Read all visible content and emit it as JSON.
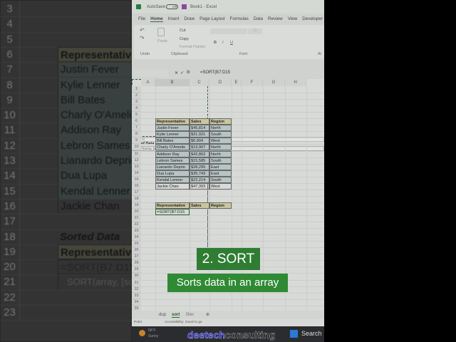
{
  "titlebar": {
    "autosave": "AutoSave",
    "toggle": "Off",
    "doc": "Book1 - Excel"
  },
  "tabs": [
    "File",
    "Home",
    "Insert",
    "Draw",
    "Page Layout",
    "Formulas",
    "Data",
    "Review",
    "View",
    "Developer"
  ],
  "ribbon": {
    "cut": "Cut",
    "copy": "Copy",
    "format_painter": "Format Painter",
    "paste": "Paste",
    "groups": [
      "Undo",
      "Clipboard",
      "Font",
      "Al"
    ],
    "font_size": "11",
    "bold": "B",
    "italic": "I",
    "underline": "U"
  },
  "formula_bar": {
    "fx": "fx",
    "formula": "=SORT(B7:D15"
  },
  "columns": [
    "A",
    "B",
    "C",
    "D",
    "E",
    "F",
    "G",
    "H"
  ],
  "table": {
    "headers": [
      "Representative",
      "Sales",
      "Region"
    ],
    "rows": [
      [
        "Justin Fever",
        "$45,814",
        "North"
      ],
      [
        "Kylie Lenner",
        "$31,921",
        "South"
      ],
      [
        "Bill Bates",
        "$6,904",
        "West"
      ],
      [
        "Charly O'Amelio",
        "$19,907",
        "North"
      ],
      [
        "Addison Ray",
        "$42,862",
        "North"
      ],
      [
        "Lebron Sames",
        "$15,585",
        "South"
      ],
      [
        "Lianardo Deprio",
        "$28,295",
        "East"
      ],
      [
        "Dua Lupa",
        "$35,743",
        "East"
      ],
      [
        "Kendal Lenner",
        "$22,214",
        "South"
      ],
      [
        "Jackie Chan",
        "$47,393",
        "West"
      ]
    ],
    "size_tip": "9R x 3C"
  },
  "sorted": {
    "title": "Sorted Data",
    "headers": [
      "Representative",
      "Sales",
      "Region"
    ],
    "formula": "=SORT(B7:D15",
    "tooltip": "SORT(array, [sort_index], [sort_order], [by_col])"
  },
  "left_zoom": {
    "formula": "=SORT(B7:D15",
    "tooltip": "SORT(array, [sc"
  },
  "sheet_tabs": [
    "dup",
    "sort",
    "filter"
  ],
  "status": {
    "mode": "Point",
    "accessibility": "Accessibility: Good to go"
  },
  "taskbar": {
    "temp": "68°F",
    "weather": "Sunny",
    "search": "Search"
  },
  "overlay": {
    "title": "2. SORT",
    "subtitle": "Sorts data in an array"
  },
  "brand": {
    "part1": "deetech",
    "part2": "consulting"
  }
}
